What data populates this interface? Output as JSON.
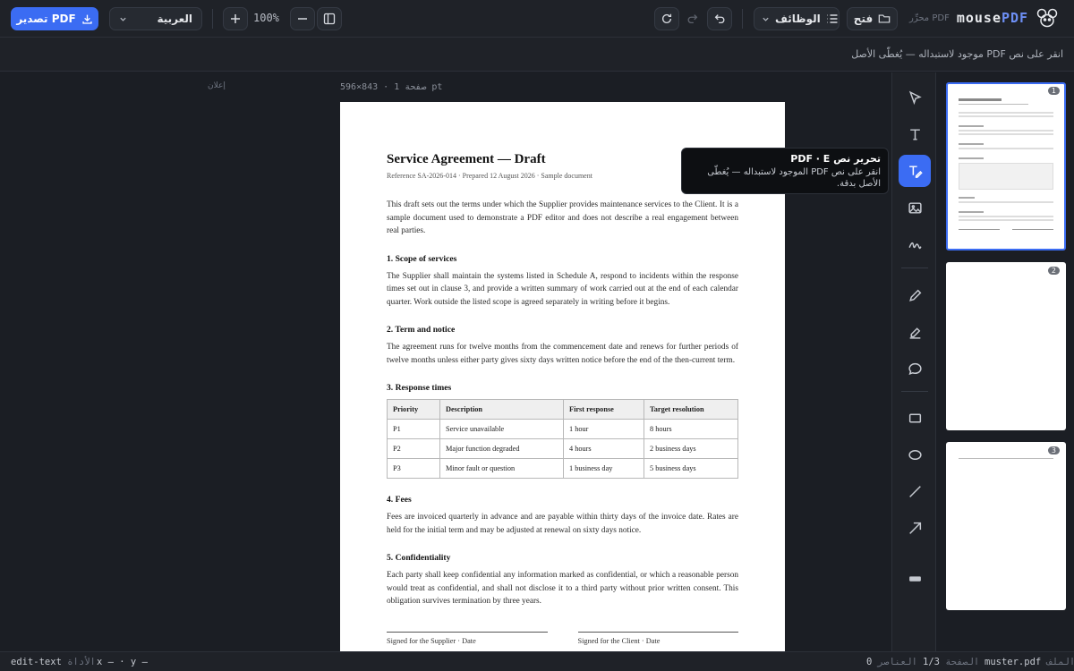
{
  "topbar": {
    "export_label": "تصدير PDF",
    "language": "العربية",
    "zoom": "100%",
    "functions_label": "الوظائف",
    "open_label": "فتح",
    "brand_sub": "محرِّر PDF",
    "brand_name_1": "mouse",
    "brand_name_2": "PDF"
  },
  "infobar": {
    "hint": "انقر على نص PDF موجود لاستبداله — يُغطّى الأصل"
  },
  "left": {
    "ad_label": "إعلان"
  },
  "canvas": {
    "page_label": "صفحة 1 · 843×596 pt",
    "document": {
      "title": "Service Agreement — Draft",
      "reference": "Reference SA-2026-014 · Prepared 12 August 2026 · Sample document",
      "intro": "This draft sets out the terms under which the Supplier provides maintenance services to the Client. It is a sample document used to demonstrate a PDF editor and does not describe a real engagement between real parties.",
      "s1_title": "1. Scope of services",
      "s1_body": "The Supplier shall maintain the systems listed in Schedule A, respond to incidents within the response times set out in clause 3, and provide a written summary of work carried out at the end of each calendar quarter. Work outside the listed scope is agreed separately in writing before it begins.",
      "s2_title": "2. Term and notice",
      "s2_body": "The agreement runs for twelve months from the commencement date and renews for further periods of twelve months unless either party gives sixty days written notice before the end of the then-current term.",
      "s3_title": "3. Response times",
      "table": {
        "headers": [
          "Priority",
          "Description",
          "First response",
          "Target resolution"
        ],
        "rows": [
          [
            "P1",
            "Service unavailable",
            "1 hour",
            "8 hours"
          ],
          [
            "P2",
            "Major function degraded",
            "4 hours",
            "2 business days"
          ],
          [
            "P3",
            "Minor fault or question",
            "1 business day",
            "5 business days"
          ]
        ]
      },
      "s4_title": "4. Fees",
      "s4_body": "Fees are invoiced quarterly in advance and are payable within thirty days of the invoice date. Rates are held for the initial term and may be adjusted at renewal on sixty days notice.",
      "s5_title": "5. Confidentiality",
      "s5_body": "Each party shall keep confidential any information marked as confidential, or which a reasonable person would treat as confidential, and shall not disclose it to a third party without prior written consent. This obligation survives termination by three years.",
      "sig_supplier": "Signed for the Supplier · Date",
      "sig_client": "Signed for the Client · Date"
    }
  },
  "tooltip": {
    "title": "تحرير نص PDF · E",
    "desc": "انقر على نص PDF الموجود لاستبداله — يُغطّى الأصل بدقة."
  },
  "tools": [
    "select-icon",
    "text-icon",
    "edit-text-icon",
    "image-icon",
    "signature-icon",
    "pen-icon",
    "highlighter-icon",
    "comment-icon",
    "rectangle-icon",
    "ellipse-icon",
    "line-icon",
    "arrow-icon",
    "redact-icon"
  ],
  "thumbnails": [
    {
      "num": "1"
    },
    {
      "num": "2"
    },
    {
      "num": "3"
    }
  ],
  "status": {
    "file_label": "الملف",
    "file_name": "muster.pdf",
    "page_label": "الصفحة",
    "page_value": "1/3",
    "elements_label": "العناصر",
    "elements_value": "0",
    "tool_label": "الأداة",
    "tool_value": "edit-text",
    "coords": "x — · y —"
  },
  "colors": {
    "accent": "#3b6cf3",
    "background": "#1b1e24",
    "panel": "#1f2228"
  }
}
